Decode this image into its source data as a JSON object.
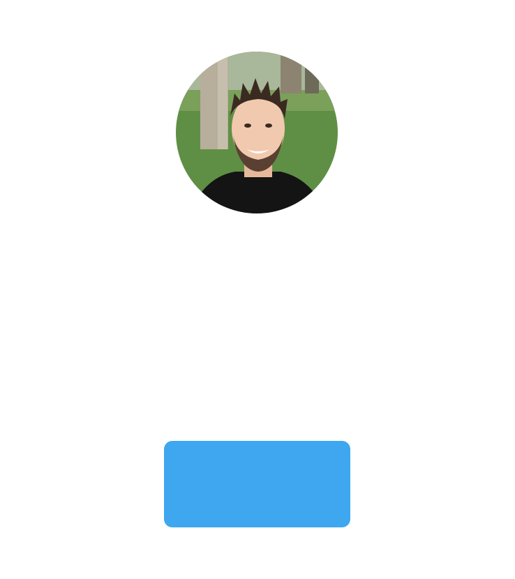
{
  "profile": {
    "avatar_alt": "profile photo",
    "name": ""
  },
  "action": {
    "button_label": ""
  },
  "colors": {
    "button_background": "#3ea7f0",
    "page_background": "#ffffff"
  }
}
